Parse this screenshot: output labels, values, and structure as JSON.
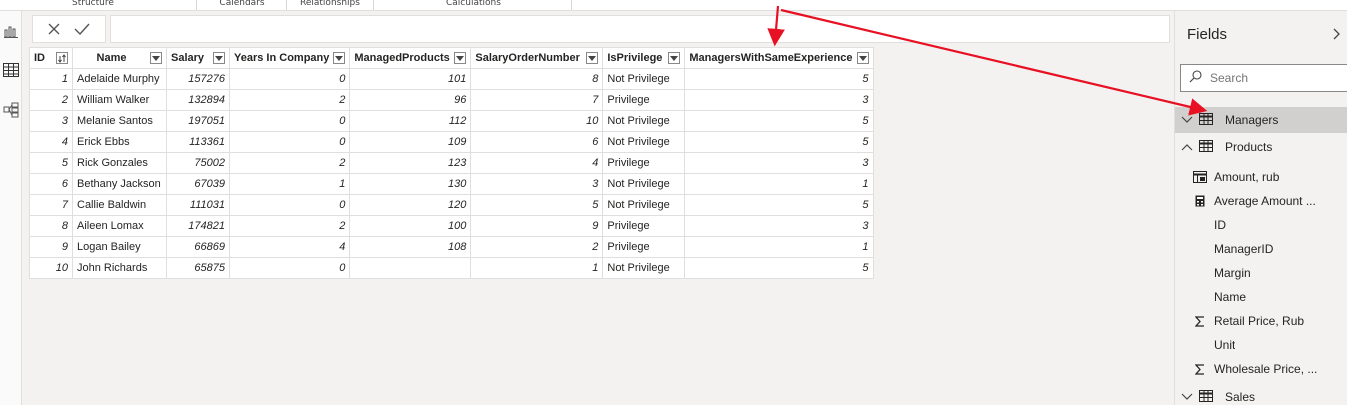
{
  "ribbon": {
    "groups": [
      "Structure",
      "Calendars",
      "Relationships",
      "Calculations"
    ]
  },
  "formula_bar": {
    "cancel_icon": "close-icon",
    "commit_icon": "check-icon",
    "value": ""
  },
  "table": {
    "columns": [
      "ID",
      "Name",
      "Salary",
      "Years In Company",
      "ManagedProducts",
      "SalaryOrderNumber",
      "IsPrivilege",
      "ManagersWithSameExperience"
    ],
    "rows": [
      [
        "1",
        "Adelaide Murphy",
        "157276",
        "0",
        "101",
        "8",
        "Not Privilege",
        "5"
      ],
      [
        "2",
        "William Walker",
        "132894",
        "2",
        "96",
        "7",
        "Privilege",
        "3"
      ],
      [
        "3",
        "Melanie Santos",
        "197051",
        "0",
        "112",
        "10",
        "Not Privilege",
        "5"
      ],
      [
        "4",
        "Erick Ebbs",
        "113361",
        "0",
        "109",
        "6",
        "Not Privilege",
        "5"
      ],
      [
        "5",
        "Rick Gonzales",
        "75002",
        "2",
        "123",
        "4",
        "Privilege",
        "3"
      ],
      [
        "6",
        "Bethany Jackson",
        "67039",
        "1",
        "130",
        "3",
        "Not Privilege",
        "1"
      ],
      [
        "7",
        "Callie Baldwin",
        "111031",
        "0",
        "120",
        "5",
        "Not Privilege",
        "5"
      ],
      [
        "8",
        "Aileen Lomax",
        "174821",
        "2",
        "100",
        "9",
        "Privilege",
        "3"
      ],
      [
        "9",
        "Logan Bailey",
        "66869",
        "4",
        "108",
        "2",
        "Privilege",
        "1"
      ],
      [
        "10",
        "John Richards",
        "65875",
        "0",
        "",
        "1",
        "Not Privilege",
        "5"
      ]
    ]
  },
  "fields": {
    "title": "Fields",
    "search_placeholder": "Search",
    "tables": [
      {
        "name": "Managers",
        "selected": true,
        "expanded": false
      },
      {
        "name": "Products",
        "selected": false,
        "expanded": true
      },
      {
        "name": "Sales",
        "selected": false,
        "expanded": false
      }
    ],
    "product_fields": [
      {
        "label": "Amount, rub",
        "icon": "table-measure-icon"
      },
      {
        "label": "Average Amount ...",
        "icon": "calculator-icon"
      },
      {
        "label": "ID",
        "icon": ""
      },
      {
        "label": "ManagerID",
        "icon": ""
      },
      {
        "label": "Margin",
        "icon": ""
      },
      {
        "label": "Name",
        "icon": ""
      },
      {
        "label": "Retail Price, Rub",
        "icon": "sigma-icon"
      },
      {
        "label": "Unit",
        "icon": ""
      },
      {
        "label": "Wholesale Price, ...",
        "icon": "sigma-icon"
      }
    ]
  },
  "colors": {
    "annotation_arrow": "#e81123",
    "selected_row": "#d2d0ce"
  }
}
